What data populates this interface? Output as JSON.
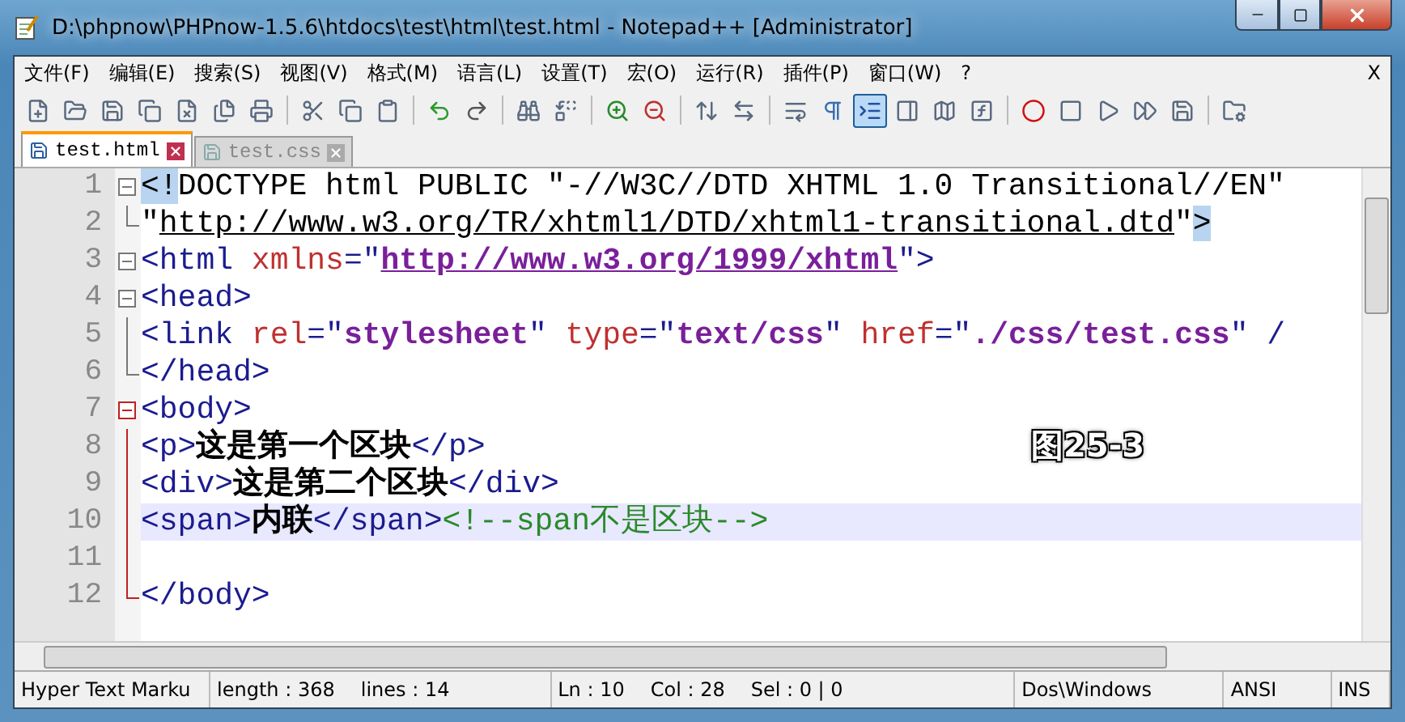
{
  "window": {
    "title": "D:\\phpnow\\PHPnow-1.5.6\\htdocs\\test\\html\\test.html - Notepad++ [Administrator]"
  },
  "menu": {
    "items": [
      "文件(F)",
      "编辑(E)",
      "搜索(S)",
      "视图(V)",
      "格式(M)",
      "语言(L)",
      "设置(T)",
      "宏(O)",
      "运行(R)",
      "插件(P)",
      "窗口(W)",
      "?"
    ],
    "close_label": "X"
  },
  "toolbar": [
    {
      "kind": "new",
      "pressed": false
    },
    {
      "kind": "open",
      "pressed": false
    },
    {
      "kind": "save",
      "pressed": false
    },
    {
      "kind": "save-all",
      "pressed": false
    },
    {
      "kind": "close",
      "pressed": false
    },
    {
      "kind": "close-all",
      "pressed": false
    },
    {
      "kind": "print",
      "pressed": false
    },
    {
      "kind": "separator"
    },
    {
      "kind": "cut",
      "pressed": false
    },
    {
      "kind": "copy",
      "pressed": false
    },
    {
      "kind": "paste",
      "pressed": false
    },
    {
      "kind": "separator"
    },
    {
      "kind": "undo",
      "pressed": false
    },
    {
      "kind": "redo",
      "pressed": false
    },
    {
      "kind": "separator"
    },
    {
      "kind": "find",
      "pressed": false
    },
    {
      "kind": "replace",
      "pressed": false
    },
    {
      "kind": "separator"
    },
    {
      "kind": "zoom-in",
      "pressed": false
    },
    {
      "kind": "zoom-out",
      "pressed": false
    },
    {
      "kind": "separator"
    },
    {
      "kind": "sync-v",
      "pressed": false
    },
    {
      "kind": "sync-h",
      "pressed": false
    },
    {
      "kind": "separator"
    },
    {
      "kind": "wrap",
      "pressed": false
    },
    {
      "kind": "pilcrow",
      "pressed": false
    },
    {
      "kind": "indent",
      "pressed": true
    },
    {
      "kind": "panel",
      "pressed": false
    },
    {
      "kind": "map",
      "pressed": false
    },
    {
      "kind": "function",
      "pressed": false
    },
    {
      "kind": "separator"
    },
    {
      "kind": "record",
      "pressed": false
    },
    {
      "kind": "stop",
      "pressed": false
    },
    {
      "kind": "play",
      "pressed": false
    },
    {
      "kind": "play-multi",
      "pressed": false
    },
    {
      "kind": "macro-save",
      "pressed": false
    },
    {
      "kind": "separator"
    },
    {
      "kind": "folder",
      "pressed": false
    }
  ],
  "tabs": [
    {
      "label": "test.html",
      "selected": true
    },
    {
      "label": "test.css",
      "selected": false
    }
  ],
  "code_lines": [
    {
      "number": "1",
      "fold": {
        "kind": "open",
        "active": false
      },
      "highlighted": false,
      "tokens": [
        {
          "kind": "brace",
          "text": "<!"
        },
        {
          "kind": "doctype",
          "text": "DOCTYPE html PUBLIC \"-//W3C//DTD XHTML 1.0 Transitional//EN\""
        }
      ]
    },
    {
      "number": "2",
      "fold": {
        "kind": "end",
        "active": false
      },
      "highlighted": false,
      "tokens": [
        {
          "kind": "doctype",
          "text": "\""
        },
        {
          "kind": "link",
          "text": "http://www.w3.org/TR/xhtml1/DTD/xhtml1-transitional.dtd"
        },
        {
          "kind": "doctype",
          "text": "\""
        },
        {
          "kind": "brace",
          "text": ">"
        }
      ]
    },
    {
      "number": "3",
      "fold": {
        "kind": "open",
        "active": false
      },
      "highlighted": false,
      "tokens": [
        {
          "kind": "tag",
          "text": "<html "
        },
        {
          "kind": "attr",
          "text": "xmlns"
        },
        {
          "kind": "tag",
          "text": "=\""
        },
        {
          "kind": "value-link",
          "text": "http://www.w3.org/1999/xhtml"
        },
        {
          "kind": "tag",
          "text": "\">"
        }
      ]
    },
    {
      "number": "4",
      "fold": {
        "kind": "open",
        "active": false
      },
      "highlighted": false,
      "tokens": [
        {
          "kind": "tag",
          "text": "<head>"
        }
      ]
    },
    {
      "number": "5",
      "fold": {
        "kind": "line",
        "active": false
      },
      "highlighted": false,
      "tokens": [
        {
          "kind": "tag",
          "text": "<link "
        },
        {
          "kind": "attr",
          "text": "rel"
        },
        {
          "kind": "tag",
          "text": "=\""
        },
        {
          "kind": "value",
          "text": "stylesheet"
        },
        {
          "kind": "tag",
          "text": "\" "
        },
        {
          "kind": "attr",
          "text": "type"
        },
        {
          "kind": "tag",
          "text": "=\""
        },
        {
          "kind": "value",
          "text": "text/css"
        },
        {
          "kind": "tag",
          "text": "\" "
        },
        {
          "kind": "attr",
          "text": "href"
        },
        {
          "kind": "tag",
          "text": "=\""
        },
        {
          "kind": "value",
          "text": "./css/test.css"
        },
        {
          "kind": "tag",
          "text": "\" /"
        }
      ]
    },
    {
      "number": "6",
      "fold": {
        "kind": "end",
        "active": false
      },
      "highlighted": false,
      "tokens": [
        {
          "kind": "tag",
          "text": "</head>"
        }
      ]
    },
    {
      "number": "7",
      "fold": {
        "kind": "open",
        "active": true
      },
      "highlighted": false,
      "tokens": [
        {
          "kind": "tag",
          "text": "<body>"
        }
      ]
    },
    {
      "number": "8",
      "fold": {
        "kind": "line",
        "active": true
      },
      "highlighted": false,
      "tokens": [
        {
          "kind": "tag",
          "text": "<p>"
        },
        {
          "kind": "text",
          "text": "这是第一个区块"
        },
        {
          "kind": "tag",
          "text": "</p>"
        }
      ]
    },
    {
      "number": "9",
      "fold": {
        "kind": "line",
        "active": true
      },
      "highlighted": false,
      "tokens": [
        {
          "kind": "tag",
          "text": "<div>"
        },
        {
          "kind": "text",
          "text": "这是第二个区块"
        },
        {
          "kind": "tag",
          "text": "</div>"
        }
      ]
    },
    {
      "number": "10",
      "fold": {
        "kind": "line",
        "active": true
      },
      "highlighted": true,
      "tokens": [
        {
          "kind": "tag",
          "text": "<span>"
        },
        {
          "kind": "text",
          "text": "内联"
        },
        {
          "kind": "tag",
          "text": "</span>"
        },
        {
          "kind": "comment",
          "text": "<!--span不是区块-->"
        }
      ]
    },
    {
      "number": "11",
      "fold": {
        "kind": "line",
        "active": true
      },
      "highlighted": false
    },
    {
      "number": "12",
      "fold": {
        "kind": "end",
        "active": true
      },
      "highlighted": false,
      "tokens": [
        {
          "kind": "tag",
          "text": "</body>"
        }
      ]
    }
  ],
  "figure_label": "图25-3",
  "status_bar": [
    {
      "items": [
        "Hyper Text Marku"
      ]
    },
    {
      "items": [
        "length : 368",
        "lines : 14"
      ]
    },
    {
      "items": [
        "Ln : 10",
        "Col : 28",
        "Sel : 0 | 0"
      ]
    },
    {
      "items": [
        "Dos\\Windows"
      ]
    },
    {
      "items": [
        "ANSI"
      ]
    },
    {
      "items": [
        "INS"
      ]
    }
  ]
}
